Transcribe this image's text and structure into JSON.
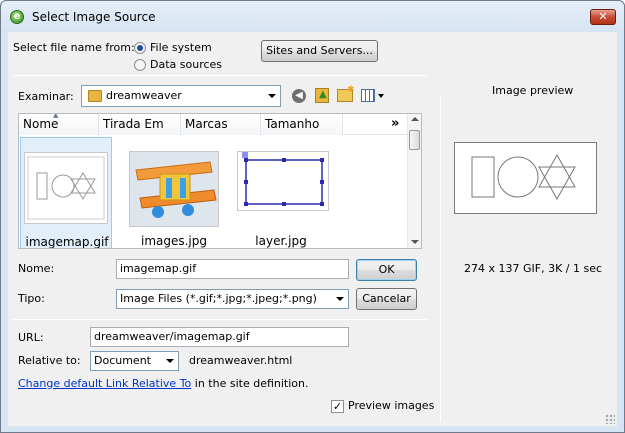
{
  "window": {
    "title": "Select Image Source",
    "close_label": "✕",
    "app_icon_glyph": "e"
  },
  "source": {
    "label": "Select file name from:",
    "options": [
      "File system",
      "Data sources"
    ],
    "selected": 0,
    "sites_button": "Sites and Servers..."
  },
  "lookin": {
    "label": "Examinar:",
    "value": "dreamweaver"
  },
  "columns": [
    "Nome",
    "Tirada Em",
    "Marcas",
    "Tamanho"
  ],
  "columns_more": "»",
  "files": [
    {
      "name": "imagemap.gif",
      "selected": true
    },
    {
      "name": "images.jpg",
      "selected": false
    },
    {
      "name": "layer.jpg",
      "selected": false
    }
  ],
  "filename": {
    "label": "Nome:",
    "value": "imagemap.gif",
    "ok_label": "OK"
  },
  "filetype": {
    "label": "Tipo:",
    "value": "Image Files (*.gif;*.jpg;*.jpeg;*.png)",
    "cancel_label": "Cancelar"
  },
  "url": {
    "label": "URL:",
    "value": "dreamweaver/imagemap.gif"
  },
  "relative": {
    "label": "Relative to:",
    "value": "Document",
    "file": "dreamweaver.html"
  },
  "link": {
    "text": "Change default Link Relative To",
    "suffix": " in the site definition."
  },
  "preview": {
    "heading": "Image preview",
    "info": "274 x 137 GIF, 3K / 1 sec",
    "checkbox_label": "Preview images",
    "checked": true
  }
}
